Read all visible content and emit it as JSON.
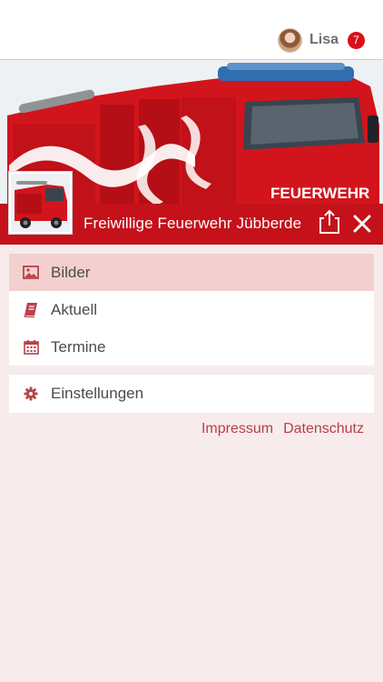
{
  "header": {
    "user_name": "Lisa",
    "notification_count": "7"
  },
  "banner": {
    "vehicle_lettering": "FEUERWEHR"
  },
  "titlebar": {
    "org_name": "Freiwillige Feuerwehr Jübberde"
  },
  "menu": {
    "items": [
      {
        "label": "Bilder",
        "icon": "image-icon",
        "active": true
      },
      {
        "label": "Aktuell",
        "icon": "book-icon",
        "active": false
      },
      {
        "label": "Termine",
        "icon": "calendar-icon",
        "active": false
      }
    ],
    "settings": {
      "label": "Einstellungen",
      "icon": "gear-icon"
    }
  },
  "footer": {
    "impressum": "Impressum",
    "datenschutz": "Datenschutz"
  },
  "colors": {
    "brand_red": "#c4111a",
    "icon_red": "#b8434b",
    "background": "#f8ebeb",
    "active_row": "#f3d0cf"
  }
}
